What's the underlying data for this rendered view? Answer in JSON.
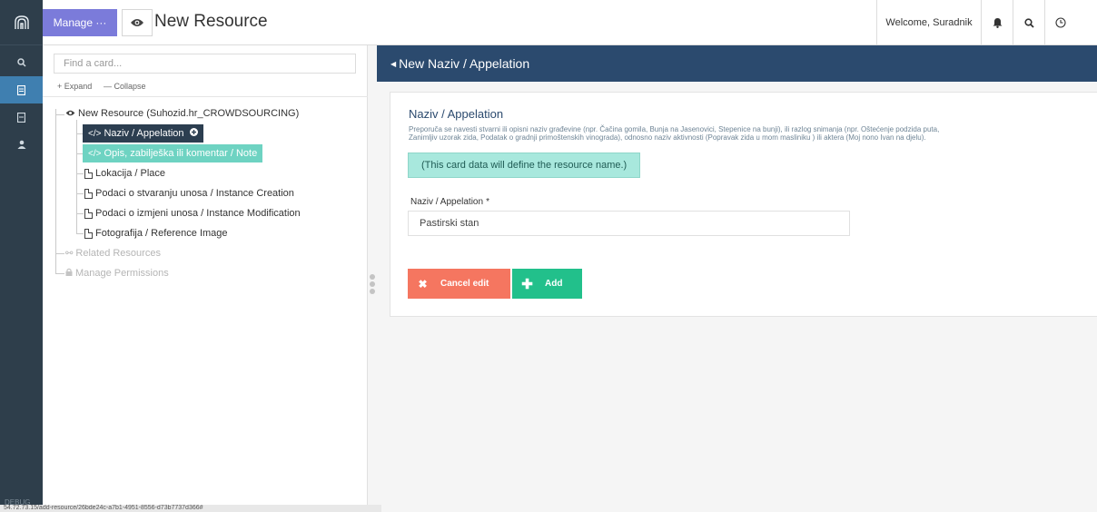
{
  "header": {
    "manage_label": "Manage ···",
    "title": "New Resource",
    "welcome": "Welcome, Suradnik"
  },
  "tree": {
    "search_placeholder": "Find a card...",
    "expand_label": "+ Expand",
    "collapse_label": "— Collapse",
    "root": "New Resource (Suhozid.hr_CROWDSOURCING)",
    "items": [
      {
        "label": "Naziv / Appelation",
        "state": "selected"
      },
      {
        "label": "Opis, zabilješka ili komentar / Note",
        "state": "highlighted"
      },
      {
        "label": "Lokacija / Place"
      },
      {
        "label": "Podaci o stvaranju unosa / Instance Creation"
      },
      {
        "label": "Podaci o izmjeni unosa / Instance Modification"
      },
      {
        "label": "Fotografija / Reference Image"
      }
    ],
    "related": "Related Resources",
    "permissions": "Manage Permissions"
  },
  "sidebar": {
    "debug": "DEBUG"
  },
  "status_url": "54.72.73.15/add-resource/26bde24c-a7b1-4951-8556-d73b7737d366#",
  "form": {
    "header": "New Naziv / Appelation",
    "card_title": "Naziv / Appelation",
    "desc_line1": "Preporuča se navesti stvarni ili opisni naziv građevine (npr. Čačina gomila, Bunja na Jasenovici, Stepenice na bunji), ili razlog snimanja (npr. Oštećenje podzida puta,",
    "desc_line2": "Zanimljiv uzorak zida, Podatak o gradnji primoštenskih vinograda), odnosno naziv aktivnosti (Popravak zida u mom masliniku ) ili aktera (Moj nono Ivan na djelu).",
    "note": "(This card data will define the resource name.)",
    "field_label": "Naziv / Appelation",
    "field_required": "*",
    "field_value": "Pastirski stan",
    "cancel_label": "Cancel edit",
    "add_label": "Add"
  },
  "colors": {
    "rail": "#2e3e4b",
    "manage": "#7b7bda",
    "form_header": "#2b4a6e",
    "cancel": "#f57660",
    "add": "#22c08b",
    "highlight": "#6ed3c2"
  }
}
